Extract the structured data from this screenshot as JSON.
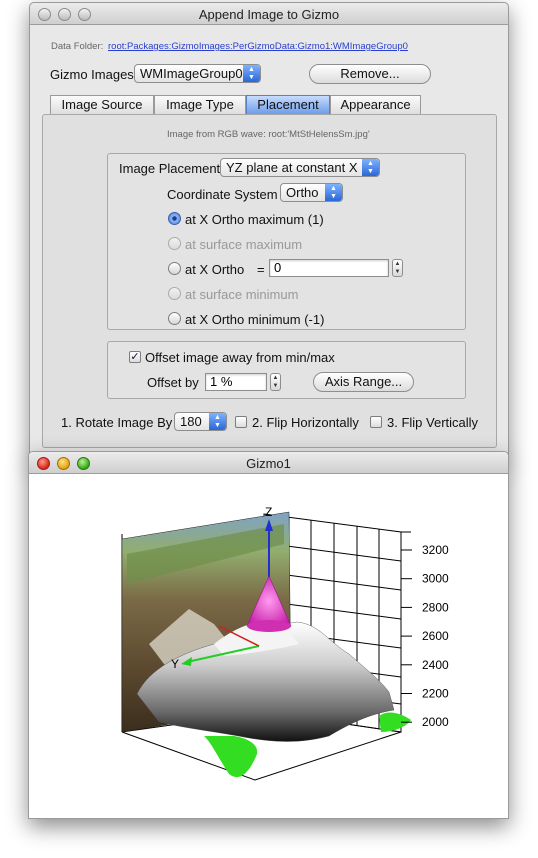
{
  "dialog": {
    "title": "Append Image to Gizmo",
    "data_folder_label": "Data Folder:",
    "data_folder_path": "root:Packages:GizmoImages:PerGizmoData:Gizmo1:WMImageGroup0",
    "gizmo_images_label": "Gizmo Images",
    "gizmo_images_value": "WMImageGroup0",
    "remove_label": "Remove...",
    "tabs": [
      {
        "label": "Image Source",
        "selected": false
      },
      {
        "label": "Image Type",
        "selected": false
      },
      {
        "label": "Placement",
        "selected": true
      },
      {
        "label": "Appearance",
        "selected": false
      }
    ],
    "image_from_text": "Image from RGB wave: root:'MtStHelensSm.jpg'",
    "image_placement_label": "Image Placement",
    "image_placement_value": "YZ plane at constant X",
    "coordinate_system_label": "Coordinate System",
    "coordinate_system_value": "Ortho",
    "options": {
      "xmax": "at X Ortho maximum (1)",
      "surf_max": "at surface maximum",
      "xortho": "at X Ortho",
      "eq": "=",
      "xortho_value": "0",
      "surf_min": "at surface minimum",
      "xmin": "at X Ortho minimum (-1)"
    },
    "offset_checkbox_label": "Offset image away from min/max",
    "offset_checked": true,
    "offset_by_label": "Offset by",
    "offset_by_value": "1 %",
    "axis_range_label": "Axis Range...",
    "rotate_label": "1. Rotate Image By",
    "rotate_value": "180",
    "flip_h_label": "2. Flip Horizontally",
    "flip_v_label": "3. Flip Vertically"
  },
  "gizmo": {
    "title": "Gizmo1",
    "z_axis_label": "Z",
    "y_axis_label": "Y",
    "z_ticks": [
      "3200",
      "3000",
      "2800",
      "2600",
      "2400",
      "2200",
      "2000"
    ],
    "colors": {
      "arrow": "#e23ac6",
      "green": "#33dd22",
      "z_axis": "#1f2fd1"
    }
  }
}
